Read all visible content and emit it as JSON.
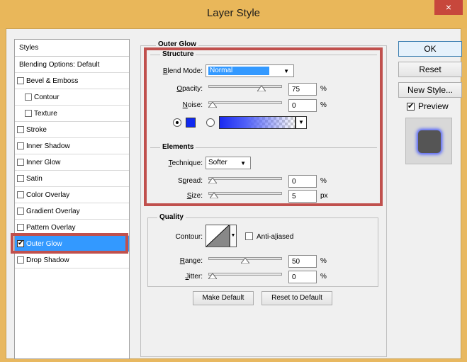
{
  "window": {
    "title": "Layer Style",
    "close_glyph": "×"
  },
  "styles_panel": {
    "header": "Styles",
    "blending_options": "Blending Options: Default",
    "items": [
      {
        "label": "Bevel & Emboss",
        "checked": false,
        "sub": false
      },
      {
        "label": "Contour",
        "checked": false,
        "sub": true
      },
      {
        "label": "Texture",
        "checked": false,
        "sub": true
      },
      {
        "label": "Stroke",
        "checked": false,
        "sub": false
      },
      {
        "label": "Inner Shadow",
        "checked": false,
        "sub": false
      },
      {
        "label": "Inner Glow",
        "checked": false,
        "sub": false
      },
      {
        "label": "Satin",
        "checked": false,
        "sub": false
      },
      {
        "label": "Color Overlay",
        "checked": false,
        "sub": false
      },
      {
        "label": "Gradient Overlay",
        "checked": false,
        "sub": false
      },
      {
        "label": "Pattern Overlay",
        "checked": false,
        "sub": false
      },
      {
        "label": "Outer Glow",
        "checked": true,
        "sub": false,
        "selected": true
      },
      {
        "label": "Drop Shadow",
        "checked": false,
        "sub": false
      }
    ]
  },
  "outer_glow": {
    "group_title": "Outer Glow",
    "structure": {
      "title": "Structure",
      "blend_mode_label": "Blend Mode:",
      "blend_mode_value": "Normal",
      "opacity_label": "Opacity:",
      "opacity_value": "75",
      "opacity_unit": "%",
      "opacity_level": 0.75,
      "noise_label": "Noise:",
      "noise_value": "0",
      "noise_unit": "%",
      "noise_level": 0,
      "color_swatch": "#1029f0",
      "color_mode": "solid"
    },
    "elements": {
      "title": "Elements",
      "technique_label": "Technique:",
      "technique_value": "Softer",
      "spread_label": "Spread:",
      "spread_value": "0",
      "spread_unit": "%",
      "spread_level": 0,
      "size_label": "Size:",
      "size_value": "5",
      "size_unit": "px",
      "size_level": 0.02
    },
    "quality": {
      "title": "Quality",
      "contour_label": "Contour:",
      "anti_aliased_label": "Anti-aliased",
      "anti_aliased_checked": false,
      "range_label": "Range:",
      "range_value": "50",
      "range_unit": "%",
      "range_level": 0.5,
      "jitter_label": "Jitter:",
      "jitter_value": "0",
      "jitter_unit": "%",
      "jitter_level": 0
    },
    "make_default": "Make Default",
    "reset_default": "Reset to Default"
  },
  "actions": {
    "ok": "OK",
    "reset": "Reset",
    "new_style": "New Style...",
    "preview_label": "Preview",
    "preview_checked": true
  },
  "colors": {
    "highlight_border": "#c0504d",
    "selection": "#3399ff",
    "glow": "#4a5cff"
  }
}
